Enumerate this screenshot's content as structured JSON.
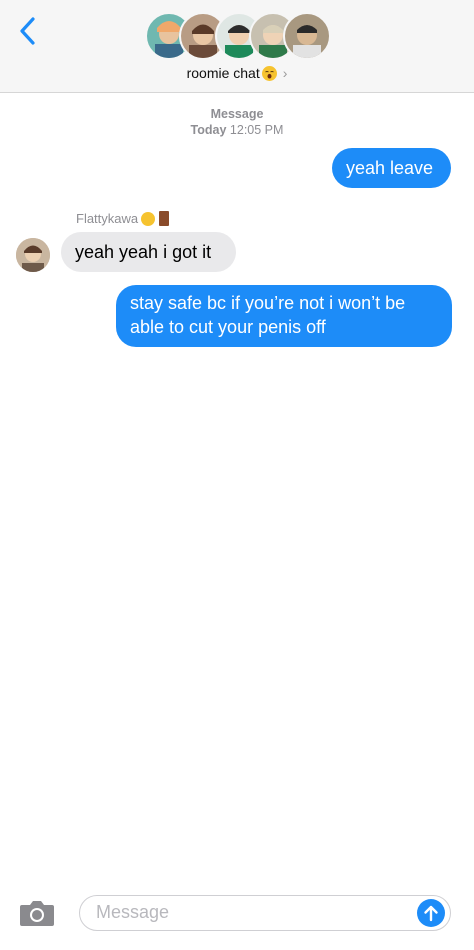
{
  "header": {
    "chat_name": "roomie chat",
    "title_emoji": "yawning-face-icon",
    "participants": [
      "participant-1",
      "participant-2",
      "participant-3",
      "participant-4",
      "participant-5"
    ]
  },
  "timestamp": {
    "service": "Message",
    "day": "Today",
    "time": "12:05 PM"
  },
  "messages": [
    {
      "direction": "outgoing",
      "text": "yeah leave"
    },
    {
      "direction": "incoming",
      "sender": "Flattykawa",
      "text": "yeah yeah i got it"
    },
    {
      "direction": "outgoing",
      "text": "stay safe bc if you’re not i won’t be able to cut your penis off"
    }
  ],
  "composer": {
    "placeholder": "Message"
  },
  "colors": {
    "accent": "#1d8cf8",
    "incoming_bubble": "#e9e9eb",
    "header_bg": "#f6f6f6"
  }
}
